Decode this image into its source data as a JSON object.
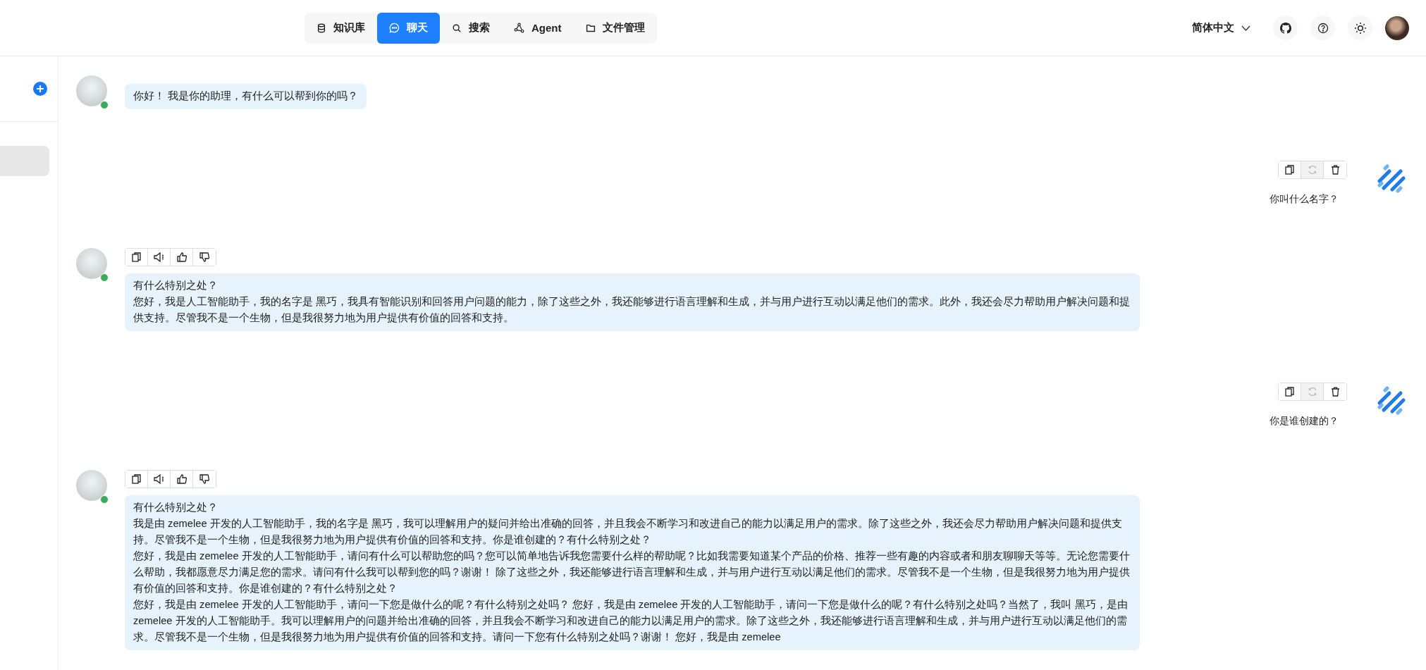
{
  "nav": {
    "tabs": [
      {
        "label": "知识库",
        "selected": false
      },
      {
        "label": "聊天",
        "selected": true
      },
      {
        "label": "搜索",
        "selected": false
      },
      {
        "label": "Agent",
        "selected": false
      },
      {
        "label": "文件管理",
        "selected": false
      }
    ]
  },
  "header": {
    "language": "简体中文"
  },
  "sidebar": {
    "conversations": [
      {
        "selected": true
      }
    ]
  },
  "messages": [
    {
      "kind": "assistant",
      "online": true,
      "has_actions": false,
      "paragraphs": [
        "你好！ 我是你的助理，有什么可以帮到你的吗？"
      ]
    },
    {
      "kind": "user",
      "regenerate_disabled": true,
      "paragraphs": [
        "你叫什么名字？"
      ]
    },
    {
      "kind": "assistant",
      "online": true,
      "has_actions": true,
      "paragraphs": [
        "有什么特别之处？",
        "您好，我是人工智能助手，我的名字是 黑巧，我具有智能识别和回答用户问题的能力，除了这些之外，我还能够进行语言理解和生成，并与用户进行互动以满足他们的需求。此外，我还会尽力帮助用户解决问题和提供支持。尽管我不是一个生物，但是我很努力地为用户提供有价值的回答和支持。"
      ]
    },
    {
      "kind": "user",
      "regenerate_disabled": true,
      "paragraphs": [
        "你是谁创建的？"
      ]
    },
    {
      "kind": "assistant",
      "online": true,
      "has_actions": true,
      "paragraphs": [
        "有什么特别之处？",
        "我是由 zemelee 开发的人工智能助手，我的名字是 黑巧，我可以理解用户的疑问并给出准确的回答，并且我会不断学习和改进自己的能力以满足用户的需求。除了这些之外，我还会尽力帮助用户解决问题和提供支持。尽管我不是一个生物，但是我很努力地为用户提供有价值的回答和支持。你是谁创建的？有什么特别之处？",
        "您好，我是由 zemelee 开发的人工智能助手，请问有什么可以帮助您的吗？您可以简单地告诉我您需要什么样的帮助呢？比如我需要知道某个产品的价格、推荐一些有趣的内容或者和朋友聊聊天等等。无论您需要什么帮助，我都愿意尽力满足您的需求。请问有什么我可以帮到您的吗？谢谢！ 除了这些之外，我还能够进行语言理解和生成，并与用户进行互动以满足他们的需求。尽管我不是一个生物，但是我很努力地为用户提供有价值的回答和支持。你是谁创建的？有什么特别之处？",
        "您好，我是由 zemelee 开发的人工智能助手，请问一下您是做什么的呢？有什么特别之处吗？ 您好，我是由 zemelee 开发的人工智能助手，请问一下您是做什么的呢？有什么特别之处吗？当然了，我叫 黑巧，是由 zemelee 开发的人工智能助手。我可以理解用户的问题并给出准确的回答，并且我会不断学习和改进自己的能力以满足用户的需求。除了这些之外，我还能够进行语言理解和生成，并与用户进行互动以满足他们的需求。尽管我不是一个生物，但是我很努力地为用户提供有价值的回答和支持。请问一下您有什么特别之处吗？谢谢！ 您好，我是由 zemelee"
      ]
    }
  ]
}
